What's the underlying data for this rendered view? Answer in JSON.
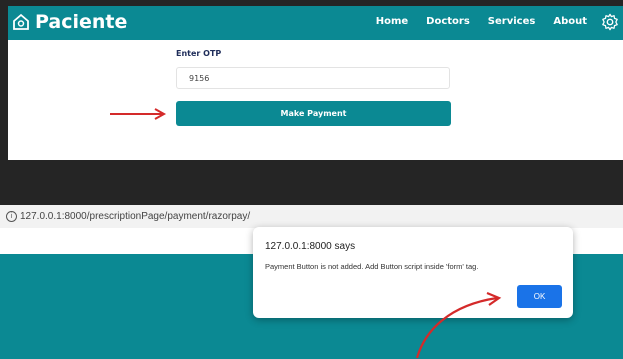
{
  "app": {
    "brand": "Paciente",
    "nav": [
      "Home",
      "Doctors",
      "Services",
      "About"
    ]
  },
  "form": {
    "otp_label": "Enter OTP",
    "otp_value": "9156",
    "pay_button": "Make Payment"
  },
  "browser": {
    "url": "127.0.0.1:8000/prescriptionPage/payment/razorpay/",
    "info_glyph": "i"
  },
  "alert": {
    "title": "127.0.0.1:8000 says",
    "message": "Payment Button is not added. Add Button script inside 'form' tag.",
    "ok": "OK"
  },
  "colors": {
    "brand_teal": "#0b8993",
    "arrow_red": "#d42a2a",
    "ok_blue": "#1a73e8"
  }
}
